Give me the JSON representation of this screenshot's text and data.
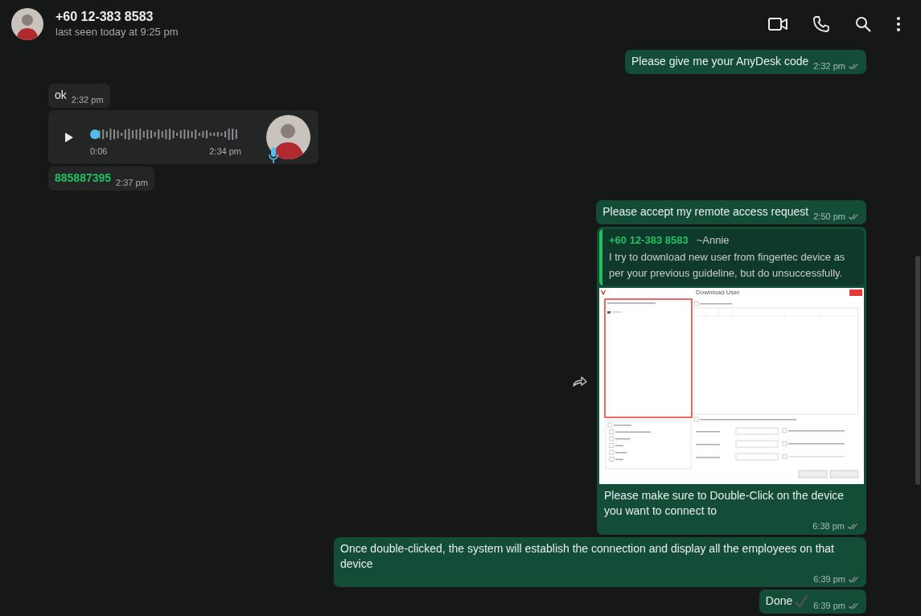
{
  "header": {
    "name": "+60 12-383 8583",
    "status": "last seen today at 9:25 pm"
  },
  "messages": [
    {
      "kind": "text",
      "outgoing": true,
      "text": "Please give me your AnyDesk code",
      "time": "2:32 pm"
    },
    {
      "kind": "text",
      "outgoing": false,
      "text": "ok",
      "time": "2:32 pm"
    },
    {
      "kind": "voice",
      "outgoing": false,
      "duration": "0:06",
      "time": "2:34 pm"
    },
    {
      "kind": "phone",
      "outgoing": false,
      "text": "885887395",
      "time": "2:37 pm"
    },
    {
      "kind": "text",
      "outgoing": true,
      "text": "Please accept my remote access request",
      "time": "2:50 pm"
    },
    {
      "kind": "reply_image",
      "outgoing": true,
      "quote": {
        "sender": "+60 12-383 8583",
        "alias": "~Annie",
        "text": "I try to download new user from fingertec device as per your previous guideline, but do unsuccessfully."
      },
      "text": "Please make sure to Double-Click on the device you want to connect to",
      "time": "6:38 pm",
      "screenshot": {
        "title": "Download User"
      }
    },
    {
      "kind": "text",
      "outgoing": true,
      "text": "Once double-clicked, the system will establish the connection and display all the employees on that device",
      "time": "6:39 pm"
    },
    {
      "kind": "done",
      "outgoing": true,
      "text": "Done",
      "time": "6:39 pm"
    }
  ]
}
